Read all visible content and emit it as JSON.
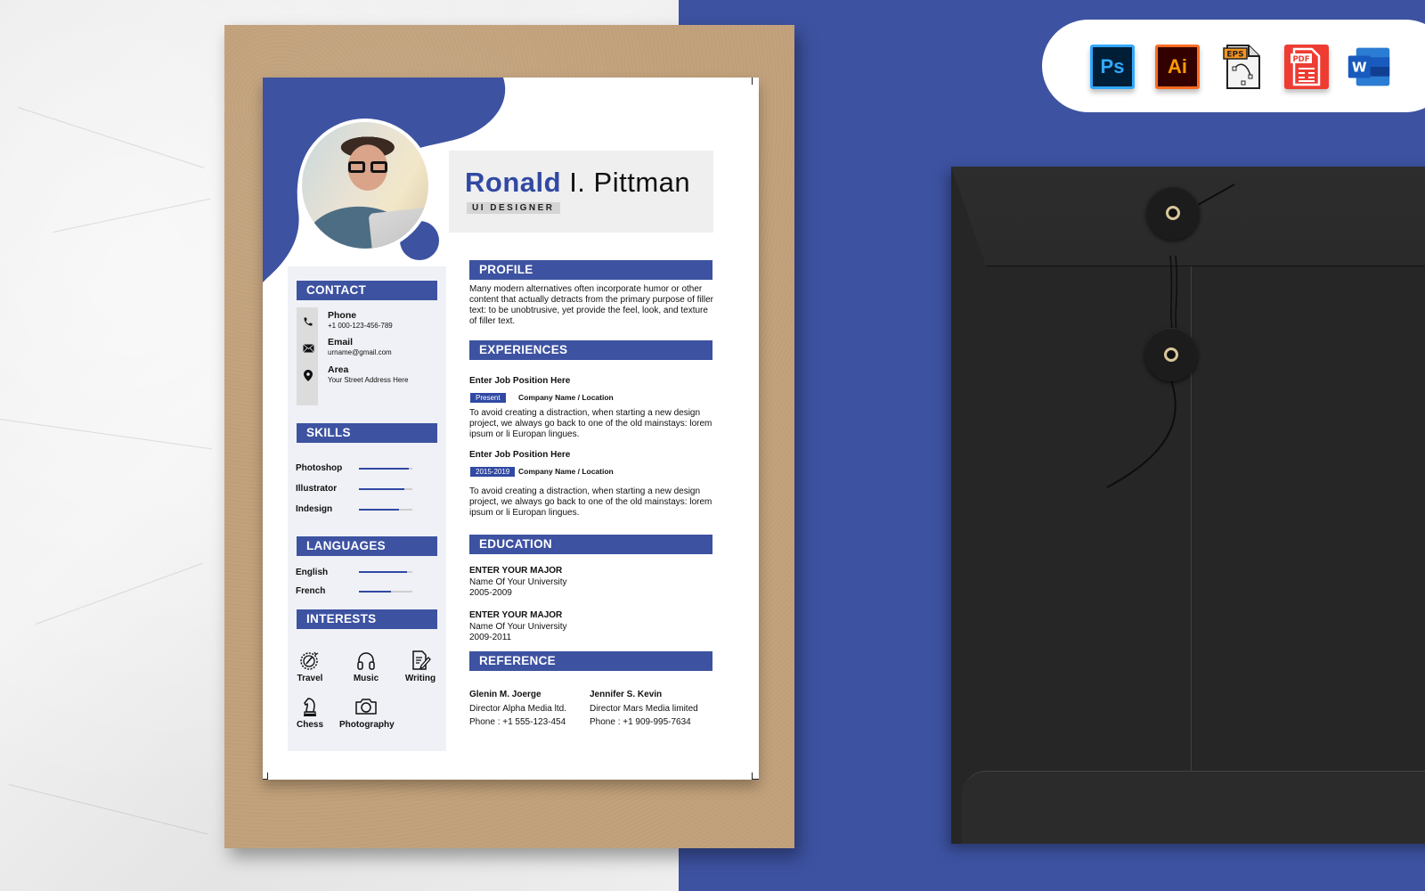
{
  "resume": {
    "name": {
      "first": "Ronald",
      "rest": "I. Pittman"
    },
    "role": "UI DESIGNER",
    "accent_color": "#3d52a1",
    "contact": {
      "heading": "CONTACT",
      "items": [
        {
          "icon": "phone-icon",
          "label": "Phone",
          "value": "+1 000-123-456-789"
        },
        {
          "icon": "envelope-icon",
          "label": "Email",
          "value": "urname@gmail.com"
        },
        {
          "icon": "location-pin-icon",
          "label": "Area",
          "value": "Your Street Address Here"
        }
      ]
    },
    "skills": {
      "heading": "SKILLS",
      "items": [
        {
          "label": "Photoshop",
          "level": 0.93
        },
        {
          "label": "Illustrator",
          "level": 0.85
        },
        {
          "label": "Indesign",
          "level": 0.75
        }
      ]
    },
    "languages": {
      "heading": "LANGUAGES",
      "items": [
        {
          "label": "English",
          "level": 0.9
        },
        {
          "label": "French",
          "level": 0.6
        }
      ]
    },
    "interests": {
      "heading": "INTERESTS",
      "items": [
        {
          "icon": "compass-icon",
          "label": "Travel"
        },
        {
          "icon": "headphones-icon",
          "label": "Music"
        },
        {
          "icon": "document-pen-icon",
          "label": "Writing"
        },
        {
          "icon": "chess-knight-icon",
          "label": "Chess"
        },
        {
          "icon": "camera-icon",
          "label": "Photography"
        }
      ]
    },
    "profile": {
      "heading": "PROFILE",
      "text": "Many modern alternatives often incorporate humor or other content that actually detracts from the primary purpose of filler text: to be unobtrusive, yet provide the feel, look, and texture of filler text."
    },
    "experiences": {
      "heading": "EXPERIENCES",
      "items": [
        {
          "title": "Enter Job Position Here",
          "period": "Present",
          "company": "Company Name / Location",
          "text": "To avoid creating a distraction, when starting a new design project, we always go back to one of the old mainstays: lorem ipsum or li Europan lingues."
        },
        {
          "title": "Enter Job Position Here",
          "period": "2015-2019",
          "company": "Company Name / Location",
          "text": "To avoid creating a distraction, when starting a new design project, we always go back to one of the old mainstays: lorem ipsum or li Europan lingues."
        }
      ]
    },
    "education": {
      "heading": "EDUCATION",
      "items": [
        {
          "major": "ENTER YOUR MAJOR",
          "school": "Name Of Your University",
          "years": "2005-2009"
        },
        {
          "major": "ENTER YOUR MAJOR",
          "school": "Name Of Your University",
          "years": "2009-2011"
        }
      ]
    },
    "reference": {
      "heading": "REFERENCE",
      "items": [
        {
          "name": "Glenin M. Joerge",
          "position": "Director Alpha Media ltd.",
          "phone": "Phone : +1 555-123-454"
        },
        {
          "name": "Jennifer S. Kevin",
          "position": "Director Mars Media limited",
          "phone": "Phone : +1 909-995-7634"
        }
      ]
    }
  },
  "formats": {
    "items": [
      {
        "icon": "photoshop-icon",
        "label": "Ps",
        "color": "#31a8ff"
      },
      {
        "icon": "illustrator-icon",
        "label": "Ai",
        "color": "#ff9a00"
      },
      {
        "icon": "eps-file-icon",
        "label": "EPS",
        "color": "#f7941d"
      },
      {
        "icon": "pdf-file-icon",
        "label": "PDF",
        "color": "#ee3c32"
      },
      {
        "icon": "word-icon",
        "label": "W",
        "color": "#2b579a"
      }
    ]
  },
  "colors": {
    "background_blue": "#3d52a1",
    "kraft": "#c2a27c",
    "envelope": "#262626"
  }
}
